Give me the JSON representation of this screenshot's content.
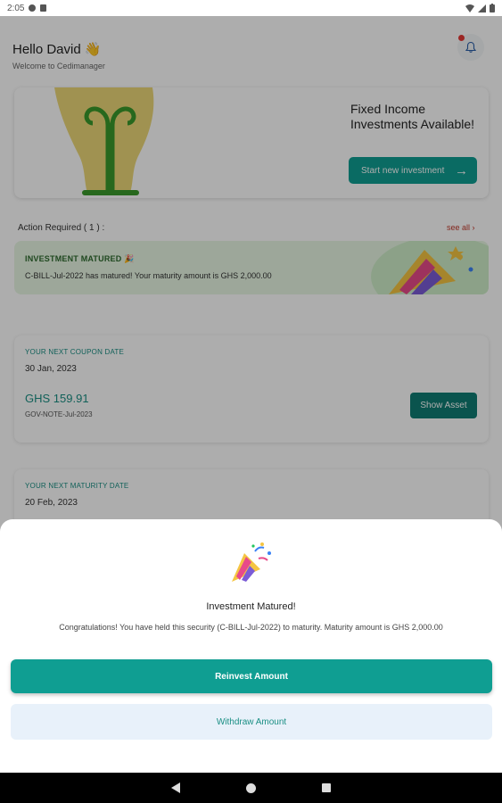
{
  "status_bar": {
    "time": "2:05",
    "battery": "▮"
  },
  "header": {
    "greeting": "Hello David 👋",
    "welcome": "Welcome to Cedimanager"
  },
  "banner": {
    "title": "Fixed Income Investments Available!",
    "button_label": "Start new investment",
    "button_icon": "arrow-right-icon"
  },
  "action_section": {
    "label": "Action Required ( 1 ) :",
    "see_all": "see all ›"
  },
  "matured_notice": {
    "title": "INVESTMENT MATURED 🎉",
    "text": "C-BILL-Jul-2022 has matured! Your maturity amount is GHS 2,000.00"
  },
  "coupon_card": {
    "label": "YOUR NEXT COUPON DATE",
    "date": "30 Jan, 2023",
    "amount": "GHS 159.91",
    "asset": "GOV-NOTE-Jul-2023",
    "button_label": "Show Asset"
  },
  "maturity_card": {
    "label": "YOUR NEXT MATURITY DATE",
    "date": "20 Feb, 2023"
  },
  "sheet": {
    "title": "Investment Matured!",
    "message": "Congratulations! You have held this security (C-BILL-Jul-2022) to maturity. Maturity amount is GHS 2,000.00",
    "reinvest_label": "Reinvest Amount",
    "withdraw_label": "Withdraw Amount"
  },
  "colors": {
    "primary": "#0f9e92",
    "primary_dark": "#0f7d73",
    "alert": "#e53935",
    "matured_bg": "#e7f6e4"
  }
}
